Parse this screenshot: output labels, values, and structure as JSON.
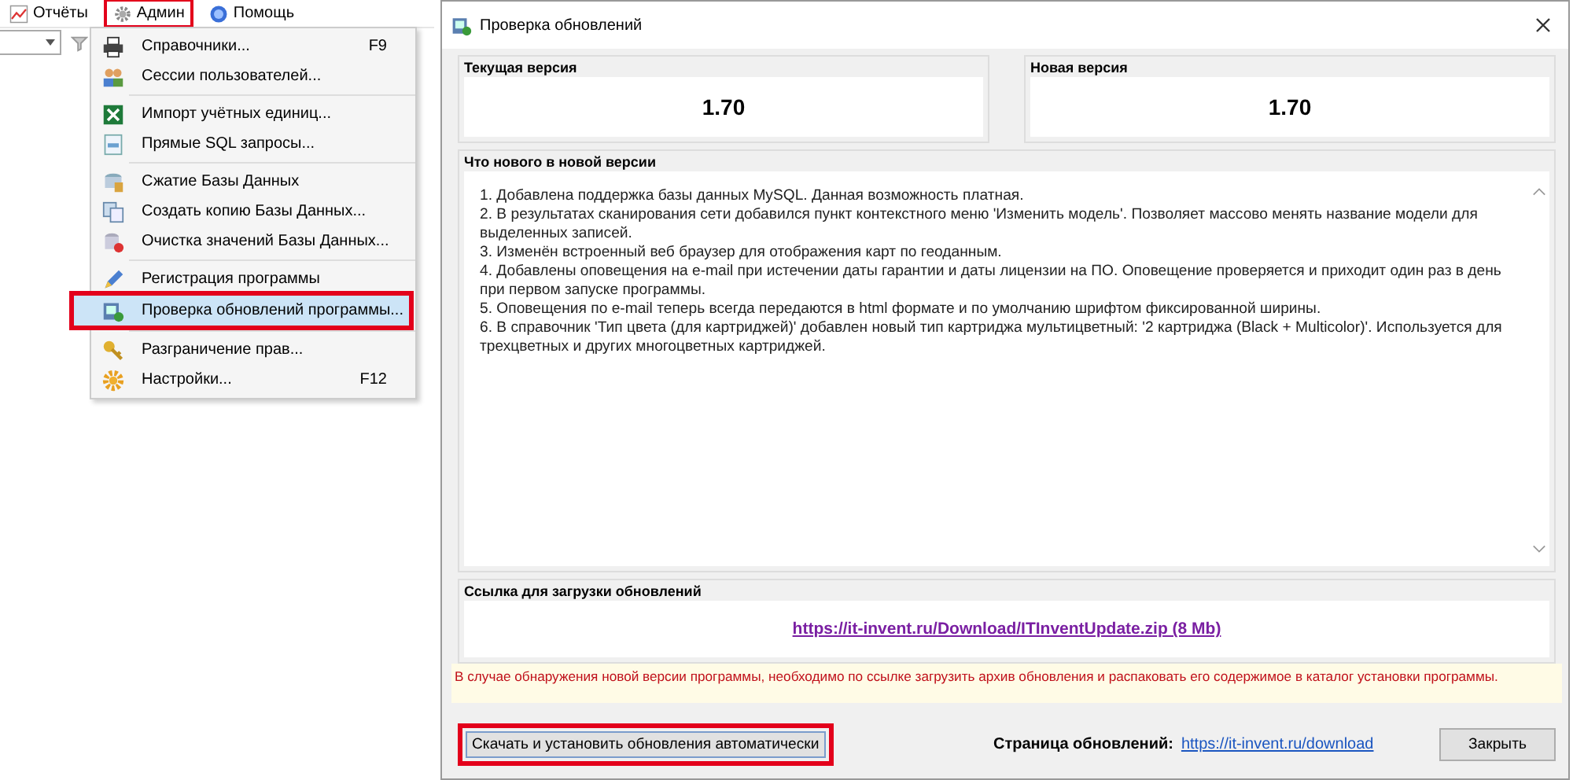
{
  "menubar": [
    {
      "label": "Отчёты",
      "highlighted": false
    },
    {
      "label": "Админ",
      "highlighted": true
    },
    {
      "label": "Помощь",
      "highlighted": false
    }
  ],
  "admin_menu": [
    {
      "kind": "item",
      "label": "Справочники...",
      "shortcut": "F9",
      "selected": false,
      "highlighted": false
    },
    {
      "kind": "item",
      "label": "Сессии пользователей...",
      "selected": false,
      "highlighted": false
    },
    {
      "kind": "separator"
    },
    {
      "kind": "item",
      "label": "Импорт учётных единиц...",
      "selected": false,
      "highlighted": false
    },
    {
      "kind": "item",
      "label": "Прямые SQL запросы...",
      "selected": false,
      "highlighted": false
    },
    {
      "kind": "separator"
    },
    {
      "kind": "item",
      "label": "Сжатие Базы Данных",
      "selected": false,
      "highlighted": false
    },
    {
      "kind": "item",
      "label": "Создать копию Базы Данных...",
      "selected": false,
      "highlighted": false
    },
    {
      "kind": "item",
      "label": "Очистка значений Базы Данных...",
      "selected": false,
      "highlighted": false
    },
    {
      "kind": "separator"
    },
    {
      "kind": "item",
      "label": "Регистрация программы",
      "selected": false,
      "highlighted": false
    },
    {
      "kind": "item",
      "label": "Проверка обновлений программы...",
      "selected": true,
      "highlighted": true
    },
    {
      "kind": "separator"
    },
    {
      "kind": "item",
      "label": "Разграничение прав...",
      "selected": false,
      "highlighted": false
    },
    {
      "kind": "item",
      "label": "Настройки...",
      "shortcut": "F12",
      "selected": false,
      "highlighted": false
    }
  ],
  "dialog": {
    "title": "Проверка обновлений",
    "current_version": {
      "label": "Текущая версия",
      "value": "1.70"
    },
    "new_version": {
      "label": "Новая версия",
      "value": "1.70"
    },
    "whats_new": {
      "label": "Что нового в новой версии",
      "items": [
        "1. Добавлена поддержка базы данных MySQL. Данная возможность платная.",
        "2. В результатах сканирования сети добавился пункт контекстного меню 'Изменить модель'. Позволяет массово менять название модели для выделенных записей.",
        "3. Изменён встроенный веб браузер для отображения карт по геоданным.",
        "4. Добавлены оповещения на e-mail при истечении даты гарантии и даты лицензии на ПО. Оповещение проверяется и приходит один раз в день при первом запуске программы.",
        "5. Оповещения по e-mail теперь всегда передаются в html формате и по умолчанию шрифтом фиксированной ширины.",
        "6. В справочник 'Тип цвета (для картриджей)' добавлен новый тип картриджа мультицветный: '2 картриджа (Black + Multicolor)'. Используется для трехцветных и других многоцветных картриджей."
      ]
    },
    "download": {
      "label": "Ссылка для загрузки обновлений",
      "link": "https://it-invent.ru/Download/ITInventUpdate.zip (8 Mb)"
    },
    "note": "В случае обнаружения новой версии программы, необходимо по ссылке загрузить архив обновления и распаковать его содержимое в каталог установки программы.",
    "auto_button": {
      "label": "Скачать и установить обновления автоматически",
      "highlighted": true
    },
    "page_label": "Страница обновлений:",
    "page_link": "https://it-invent.ru/download",
    "close_button": "Закрыть"
  }
}
